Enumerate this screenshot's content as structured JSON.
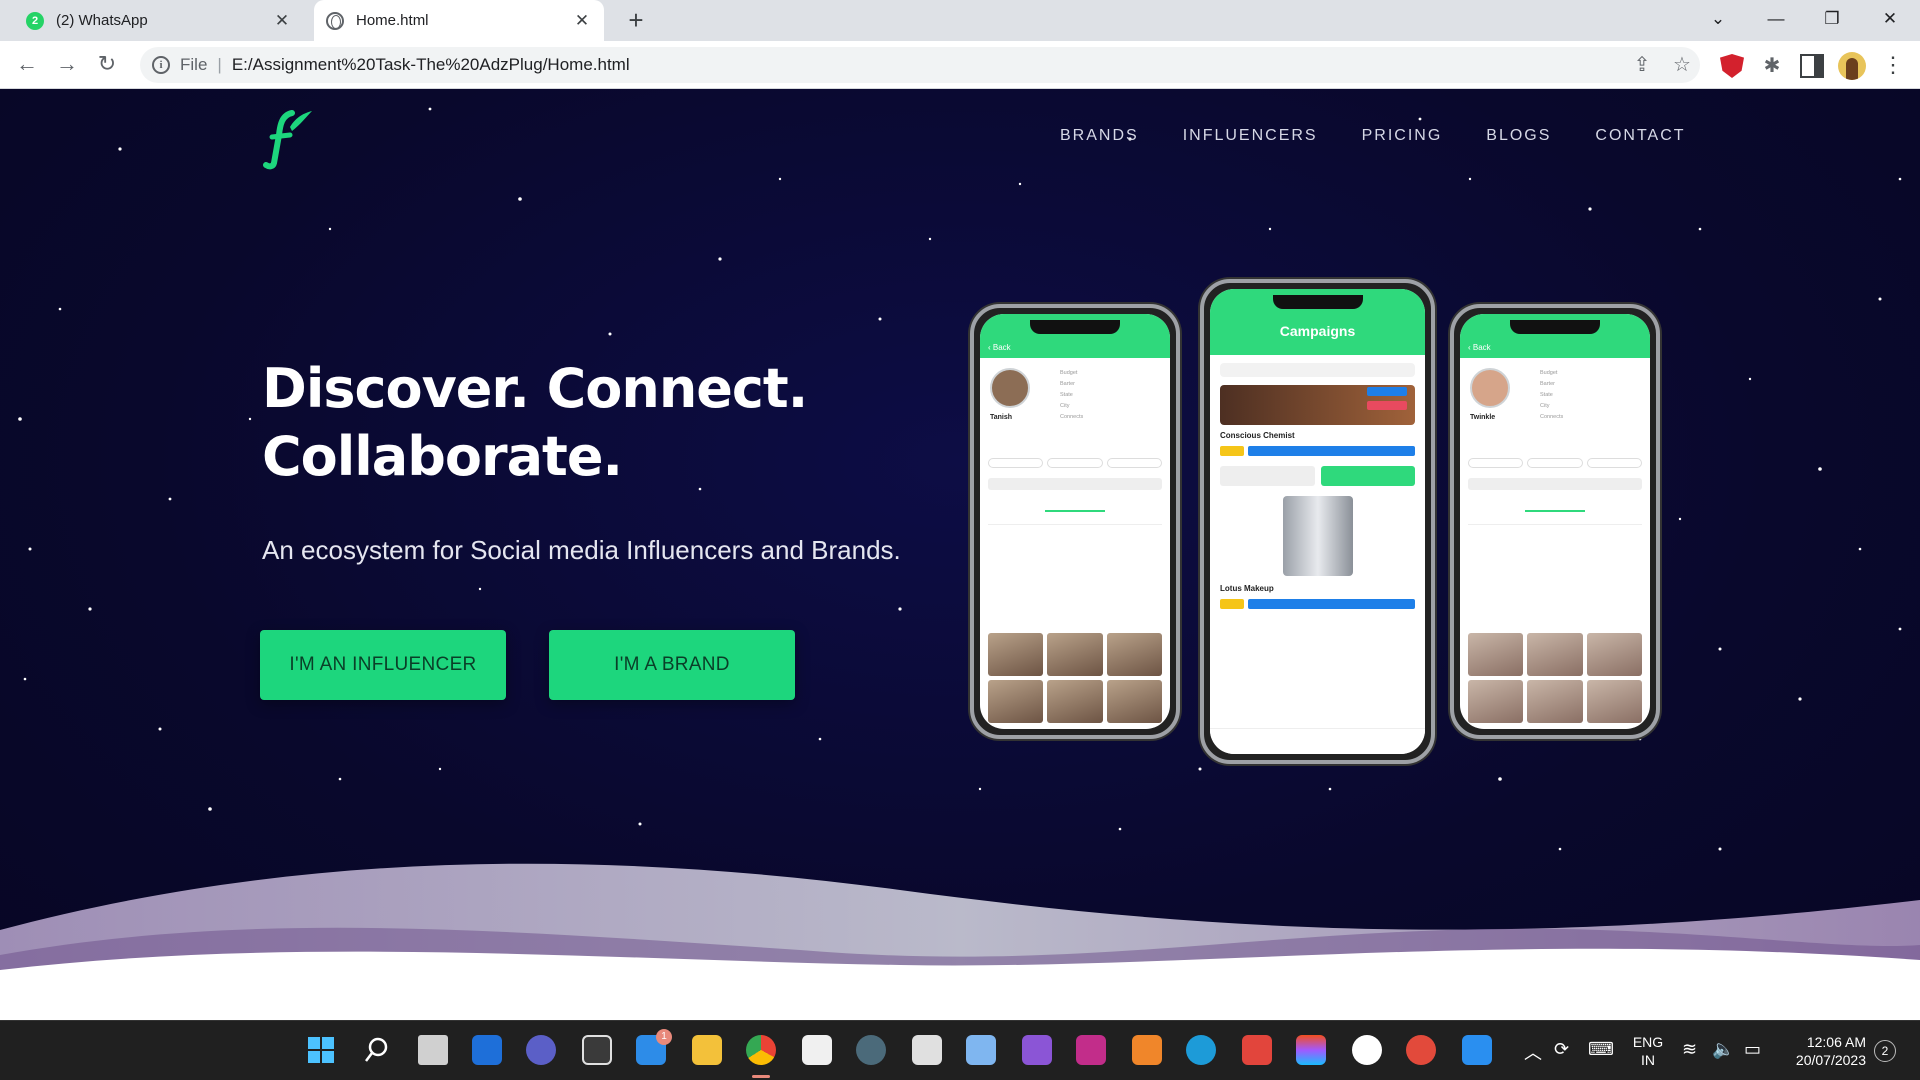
{
  "browser": {
    "tabs": [
      {
        "title": "(2) WhatsApp",
        "badge": "2",
        "active": false
      },
      {
        "title": "Home.html",
        "active": true
      }
    ],
    "new_tab_label": "+",
    "omnibox": {
      "scheme_label": "File",
      "url": "E:/Assignment%20Task-The%20AdzPlug/Home.html"
    }
  },
  "site": {
    "nav": [
      "BRANDS",
      "INFLUENCERS",
      "PRICING",
      "BLOGS",
      "CONTACT"
    ],
    "headline_line1": "Discover. Connect.",
    "headline_line2": "Collaborate.",
    "subheadline": "An ecosystem for Social media Influencers and Brands.",
    "cta_influencer": "I'M AN INFLUENCER",
    "cta_brand": "I'M A BRAND",
    "colors": {
      "accent": "#1dd67d",
      "background": "#0b0a33"
    }
  },
  "phones": {
    "middle_title": "Campaigns",
    "middle_cards": [
      "Conscious Chemist",
      "Lotus Makeup"
    ],
    "left_profile_name": "Tanish",
    "right_profile_name": "Twinkle"
  },
  "taskbar": {
    "mail_badge": "1",
    "language_top": "ENG",
    "language_bottom": "IN",
    "time": "12:06 AM",
    "date": "20/07/2023",
    "notification_count": "2"
  }
}
